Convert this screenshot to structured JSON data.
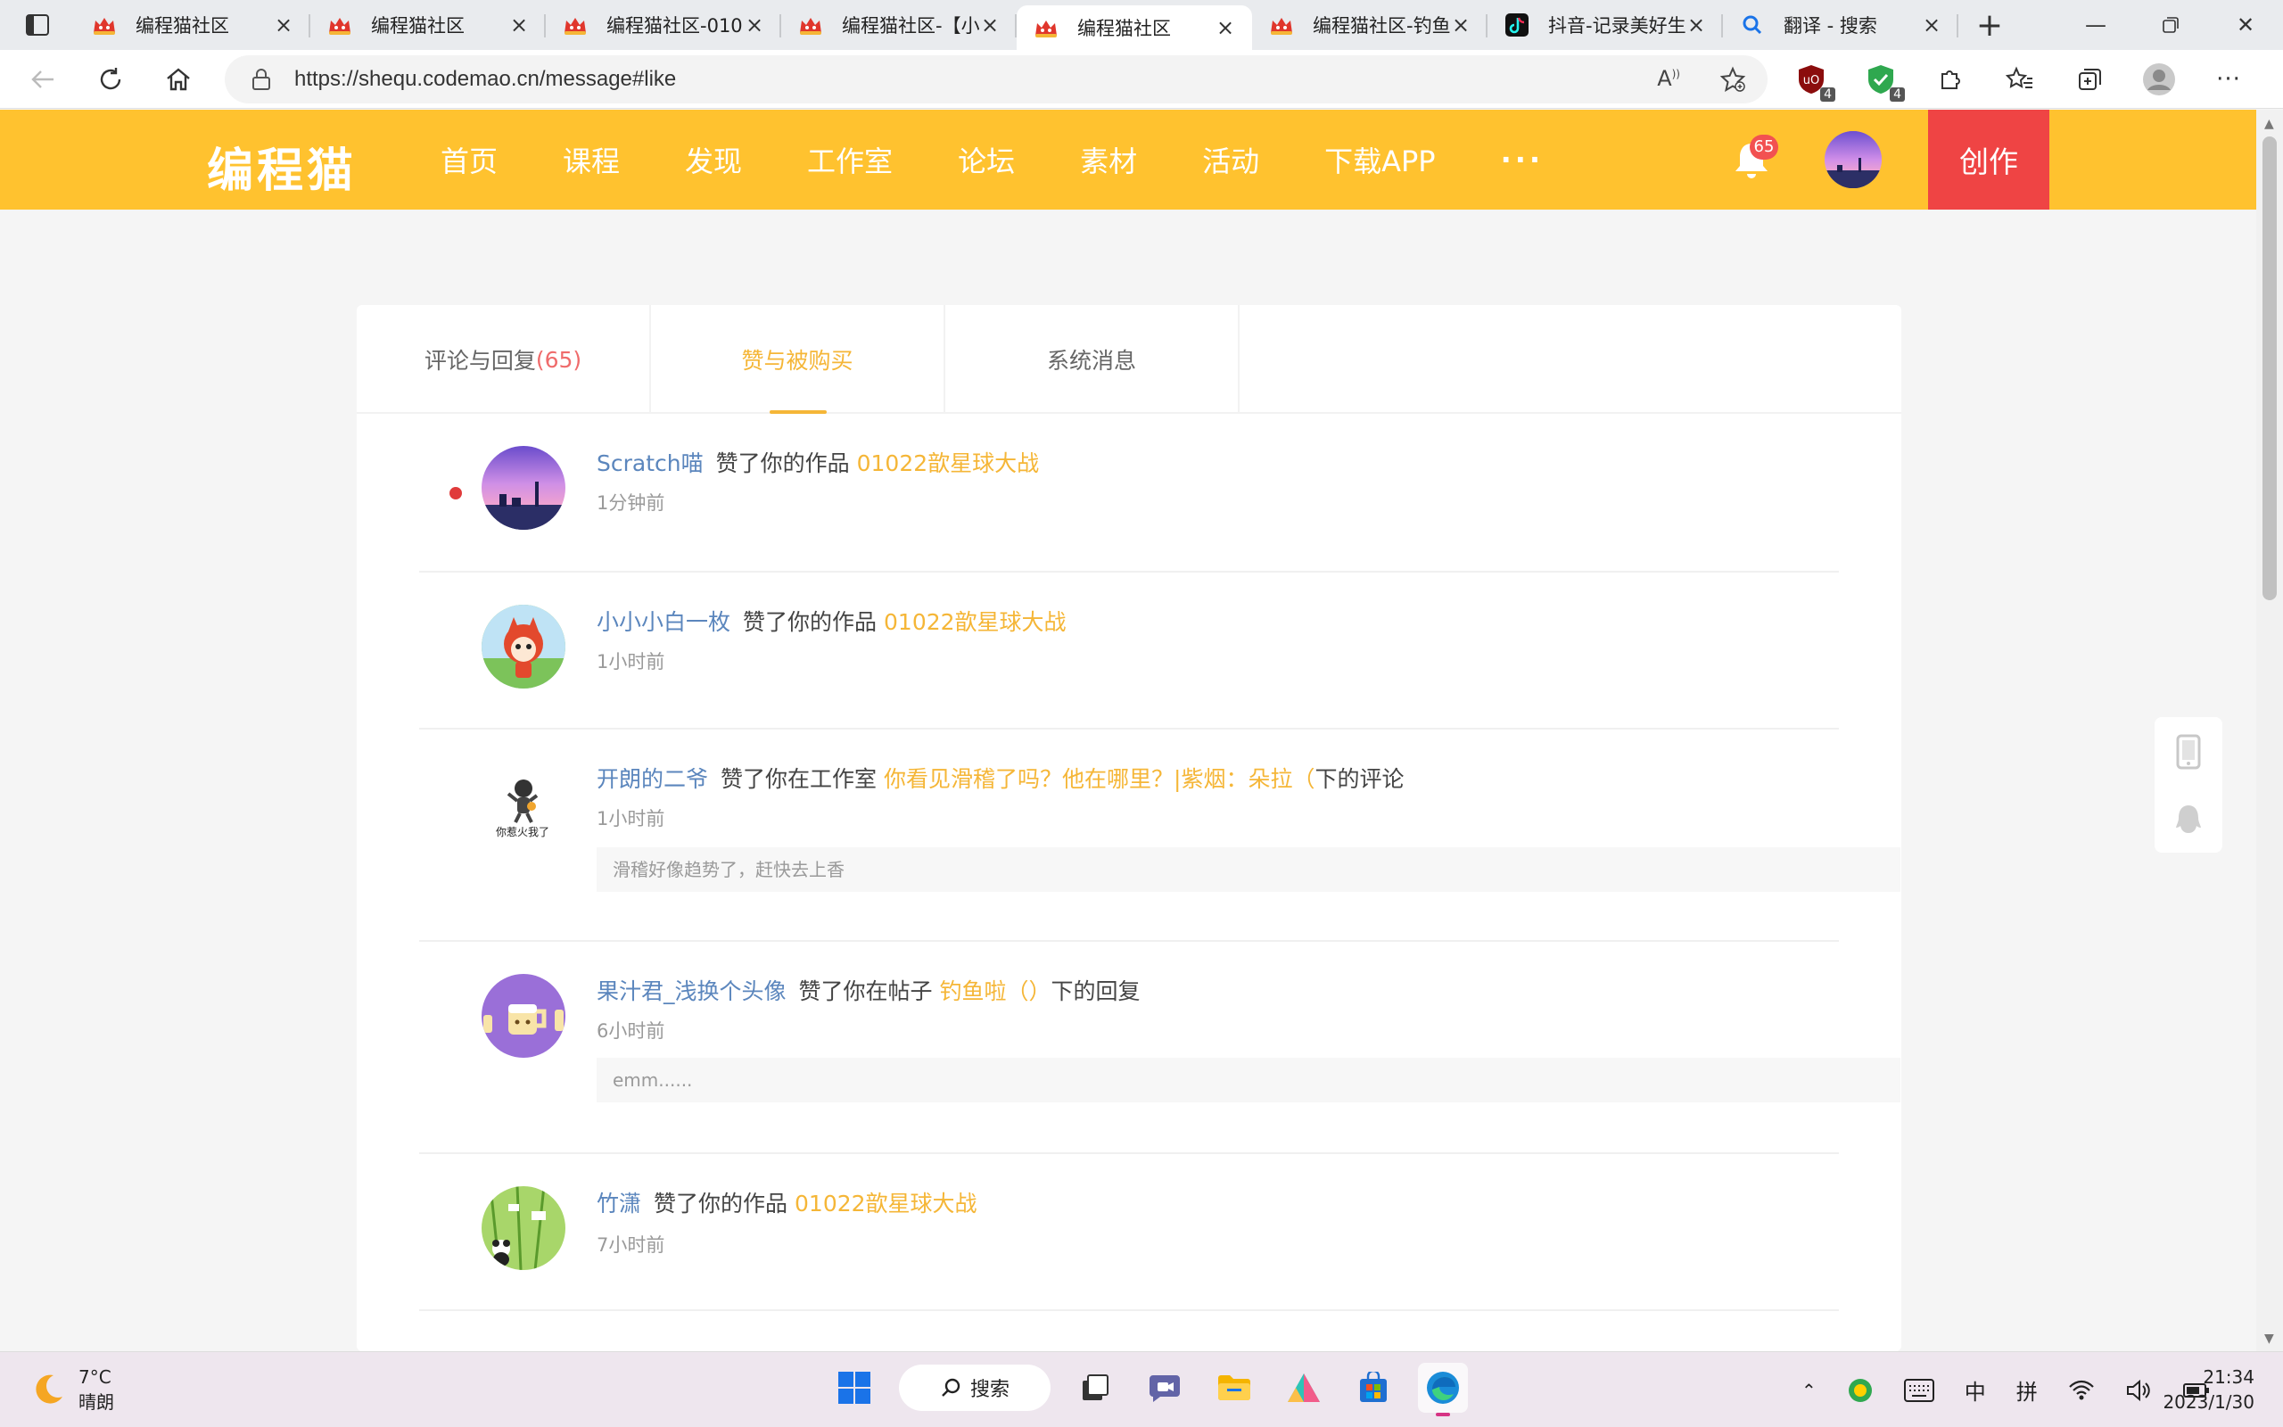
{
  "browser": {
    "tabs": [
      {
        "title": "编程猫社区",
        "favicon": "codemao"
      },
      {
        "title": "编程猫社区",
        "favicon": "codemao"
      },
      {
        "title": "编程猫社区-010",
        "favicon": "codemao"
      },
      {
        "title": "编程猫社区-【小",
        "favicon": "codemao"
      },
      {
        "title": "编程猫社区",
        "favicon": "codemao",
        "active": true
      },
      {
        "title": "编程猫社区-钓鱼",
        "favicon": "codemao"
      },
      {
        "title": "抖音-记录美好生",
        "favicon": "douyin"
      },
      {
        "title": "翻译 - 搜索",
        "favicon": "search"
      }
    ],
    "url": "https://shequ.codemao.cn/message#like",
    "extensions": [
      {
        "name": "ublock",
        "badge": "4"
      },
      {
        "name": "shield",
        "badge": "4"
      }
    ]
  },
  "site": {
    "logo": "编程猫",
    "nav": [
      "首页",
      "课程",
      "发现",
      "工作室",
      "论坛",
      "素材",
      "活动",
      "下载APP"
    ],
    "more": "···",
    "notification_count": "65",
    "create_label": "创作"
  },
  "message_tabs": [
    {
      "label": "评论与回复",
      "count": "(65)"
    },
    {
      "label": "赞与被购买",
      "count": ""
    },
    {
      "label": "系统消息",
      "count": ""
    }
  ],
  "messages": [
    {
      "user": "Scratch喵",
      "verb": "赞了你的作品",
      "target": "01022歆星球大战",
      "suffix": "",
      "time": "1分钟前",
      "unread": true,
      "quote": ""
    },
    {
      "user": "小小小白一枚",
      "verb": "赞了你的作品",
      "target": "01022歆星球大战",
      "suffix": "",
      "time": "1小时前",
      "unread": false,
      "quote": ""
    },
    {
      "user": "开朗的二爷",
      "verb": "赞了你在工作室",
      "target": "你看见滑稽了吗？他在哪里？|紫烟：朵拉（",
      "suffix": "下的评论",
      "time": "1小时前",
      "unread": false,
      "quote": "滑稽好像趋势了，赶快去上香",
      "avatar_caption": "你惹火我了"
    },
    {
      "user": "果汁君_浅换个头像",
      "verb": "赞了你在帖子",
      "target": "钓鱼啦（）",
      "suffix": "下的回复",
      "time": "6小时前",
      "unread": false,
      "quote": "emm......"
    },
    {
      "user": "竹潇",
      "verb": "赞了你的作品",
      "target": "01022歆星球大战",
      "suffix": "",
      "time": "7小时前",
      "unread": false,
      "quote": ""
    }
  ],
  "taskbar": {
    "weather_temp": "7°C",
    "weather_desc": "晴朗",
    "search_label": "搜索",
    "ime_lang": "中",
    "ime_mode": "拼",
    "time": "21:34",
    "date": "2023/1/30"
  },
  "colors": {
    "header": "#ffc22f",
    "create_button": "#ef4444",
    "accent": "#f5b637",
    "username": "#5b86bd",
    "unread_dot": "#e03b3b"
  }
}
